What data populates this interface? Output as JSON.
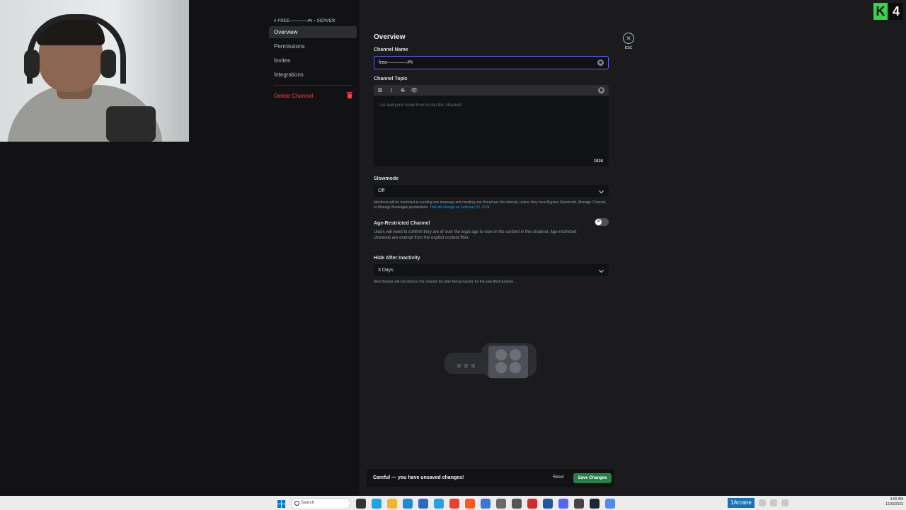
{
  "sidebar": {
    "header": "# FREE————🎮 ▪ SERVER",
    "items": [
      {
        "label": "Overview",
        "active": true
      },
      {
        "label": "Permissions"
      },
      {
        "label": "Invites"
      },
      {
        "label": "Integrations"
      }
    ],
    "delete_label": "Delete Channel"
  },
  "main": {
    "title": "Overview",
    "channel_name": {
      "label": "Channel Name",
      "value": "free————🎮"
    },
    "channel_topic": {
      "label": "Channel Topic",
      "toolbar": [
        "B",
        "I",
        "S",
        "👁"
      ],
      "placeholder": "Let everyone know how to use this channel!",
      "char_limit": "1024"
    },
    "slowmode": {
      "label": "Slowmode",
      "value": "Off",
      "note": "Members will be restricted to sending one message and creating one thread per this interval, unless they have Bypass Slowmode, Manage Channel, or Manage Messages permissions.",
      "note_link": "This will change on February 23, 2024."
    },
    "age_restricted": {
      "label": "Age-Restricted Channel",
      "desc": "Users will need to confirm they are of over the legal age to view in the content in this channel. Age-restricted channels are exempt from the explicit content filter.",
      "enabled": false
    },
    "hide_after": {
      "label": "Hide After Inactivity",
      "value": "3 Days",
      "note": "New threads will not show in the channel list after being inactive for the specified duration."
    }
  },
  "close": {
    "label": "ESC"
  },
  "unsaved_bar": {
    "message": "Careful — you have unsaved changes!",
    "reset": "Reset",
    "save": "Save Changes"
  },
  "logo": {
    "k": "K",
    "n": "4"
  },
  "taskbar": {
    "search_placeholder": "Search",
    "tray_app": "1Arcane",
    "clock_time": "3:50 AM",
    "clock_date": "12/30/2023"
  },
  "colors": {
    "accent": "#5865f2",
    "danger": "#f23f43",
    "success": "#248046",
    "link": "#00a8fc"
  }
}
